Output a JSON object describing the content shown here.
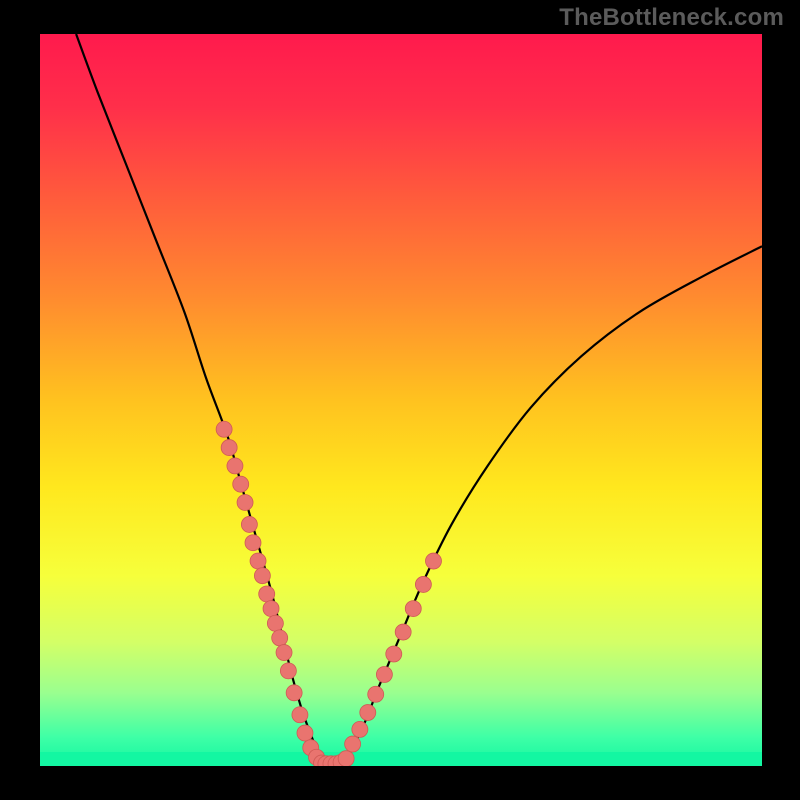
{
  "watermark": "TheBottleneck.com",
  "colors": {
    "frame": "#000000",
    "curve": "#000000",
    "points": "#e9746f",
    "pointStroke": "#cf5a55",
    "watermark": "#5b5b5b",
    "gradientStops": [
      {
        "offset": 0.0,
        "color": "#ff1a4d"
      },
      {
        "offset": 0.1,
        "color": "#ff2f4a"
      },
      {
        "offset": 0.22,
        "color": "#ff5a3c"
      },
      {
        "offset": 0.36,
        "color": "#ff8b2f"
      },
      {
        "offset": 0.5,
        "color": "#ffc21f"
      },
      {
        "offset": 0.62,
        "color": "#ffe81e"
      },
      {
        "offset": 0.74,
        "color": "#f6ff3b"
      },
      {
        "offset": 0.83,
        "color": "#d4ff66"
      },
      {
        "offset": 0.9,
        "color": "#9aff8f"
      },
      {
        "offset": 0.96,
        "color": "#3fffa6"
      },
      {
        "offset": 1.0,
        "color": "#13f7a2"
      }
    ],
    "bottomBand": "#13f7a2"
  },
  "chart_data": {
    "type": "line",
    "title": "",
    "xlabel": "",
    "ylabel": "",
    "xlim": [
      0,
      100
    ],
    "ylim": [
      0,
      100
    ],
    "grid": false,
    "legend": false,
    "series": [
      {
        "name": "bottleneck-curve",
        "x": [
          5,
          8,
          12,
          16,
          20,
          23,
          26,
          28,
          30,
          32,
          33.5,
          35,
          36.5,
          38,
          39,
          40,
          41,
          43,
          45,
          47,
          50,
          53,
          57,
          62,
          68,
          75,
          83,
          92,
          100
        ],
        "y": [
          100,
          92,
          82,
          72,
          62,
          53,
          45,
          38,
          31,
          24,
          18,
          12,
          7,
          3,
          0,
          0,
          0,
          2,
          6,
          11,
          18,
          25,
          33,
          41,
          49,
          56,
          62,
          67,
          71
        ]
      }
    ],
    "points": {
      "name": "sample-points",
      "x": [
        25.5,
        26.2,
        27.0,
        27.8,
        28.4,
        29.0,
        29.5,
        30.2,
        30.8,
        31.4,
        32.0,
        32.6,
        33.2,
        33.8,
        34.4,
        35.2,
        36.0,
        36.7,
        37.5,
        38.3,
        39.0,
        39.6,
        40.3,
        41.0,
        41.7,
        42.4,
        43.3,
        44.3,
        45.4,
        46.5,
        47.7,
        49.0,
        50.3,
        51.7,
        53.1,
        54.5
      ],
      "y": [
        46.0,
        43.5,
        41.0,
        38.5,
        36.0,
        33.0,
        30.5,
        28.0,
        26.0,
        23.5,
        21.5,
        19.5,
        17.5,
        15.5,
        13.0,
        10.0,
        7.0,
        4.5,
        2.5,
        1.2,
        0.4,
        0.3,
        0.3,
        0.3,
        0.5,
        1.0,
        3.0,
        5.0,
        7.3,
        9.8,
        12.5,
        15.3,
        18.3,
        21.5,
        24.8,
        28.0
      ]
    }
  }
}
